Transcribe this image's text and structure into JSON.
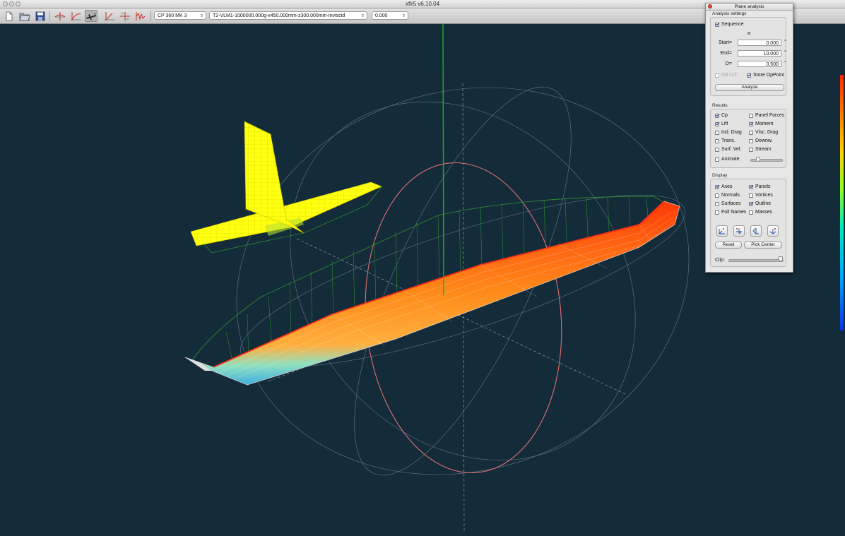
{
  "window": {
    "title": "xflr5 v6.10.04"
  },
  "toolbar": {
    "plane_select": "CP 360 MK 3",
    "polar_select": "T2-VLM1-1000000.000g-x450.000mm-z300.000mm-Inviscid",
    "opp_select": "0.000",
    "icons": [
      "new-file-icon",
      "open-file-icon",
      "save-file-icon",
      "foil-direct-icon",
      "foil-inverse-icon",
      "plane-design-icon",
      "xfoil-mixed-icon",
      "xinverse-icon",
      "polar-icon"
    ]
  },
  "panel": {
    "title": "Plane analysis",
    "analysis_settings": {
      "label": "Analysis settings",
      "sequence": "Sequence",
      "sequence_checked": true,
      "var_symbol": "a",
      "start_label": "Start=",
      "start_value": "0.000",
      "end_label": "End=",
      "end_value": "10.000",
      "delta_label": "D=",
      "delta_value": "0.500",
      "unit": "°",
      "init_llt": "Init LLT",
      "init_llt_checked": false,
      "store_opp": "Store OpPoint",
      "store_opp_checked": true,
      "analyze_button": "Analyze"
    },
    "results": {
      "label": "Results",
      "items": [
        {
          "label": "Cp",
          "checked": true
        },
        {
          "label": "Panel Forces",
          "checked": false
        },
        {
          "label": "Lift",
          "checked": true
        },
        {
          "label": "Moment",
          "checked": true
        },
        {
          "label": "Ind. Drag",
          "checked": false
        },
        {
          "label": "Visc. Drag",
          "checked": false
        },
        {
          "label": "Trans.",
          "checked": false
        },
        {
          "label": "Downw.",
          "checked": false
        },
        {
          "label": "Surf. Vel.",
          "checked": false
        },
        {
          "label": "Stream",
          "checked": false
        }
      ],
      "animate": "Animate",
      "animate_checked": false,
      "animate_speed": 0.25
    },
    "display": {
      "label": "Display",
      "items": [
        {
          "label": "Axes",
          "checked": true
        },
        {
          "label": "Panels",
          "checked": true
        },
        {
          "label": "Normals",
          "checked": false
        },
        {
          "label": "Vortices",
          "checked": false
        },
        {
          "label": "Surfaces",
          "checked": false
        },
        {
          "label": "Outline",
          "checked": true
        },
        {
          "label": "Foil Names",
          "checked": false
        },
        {
          "label": "Masses",
          "checked": false
        }
      ],
      "view_buttons": [
        "view-x-icon",
        "view-y-icon",
        "view-z-icon",
        "view-iso-icon"
      ],
      "reset_button": "Reset",
      "pick_center_button": "Pick Center",
      "clip_label": "Clip:",
      "clip_value": 1.0
    }
  },
  "colors": {
    "background": "#142b3a",
    "tail": "#ffff00",
    "wing_high": "#ff3a00",
    "wing_mid": "#ff9a20",
    "lift_lines": "#2e8a2e",
    "sphere": "#e07070"
  }
}
